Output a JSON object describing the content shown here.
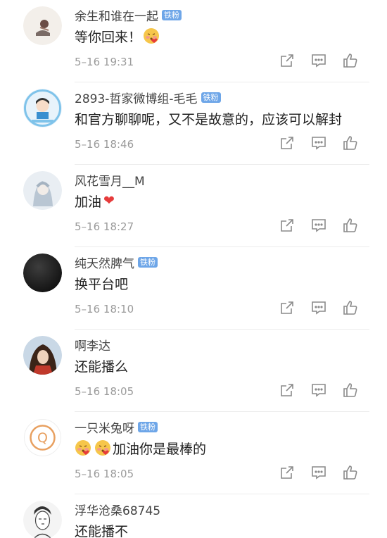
{
  "comments": [
    {
      "username": "余生和谁在一起",
      "badge": "铁粉",
      "text": "等你回来！",
      "emojis_after": 1,
      "emojis_before": 0,
      "time": "5–16 19:31",
      "avatar": "cartoon-figure"
    },
    {
      "username": "2893-哲家微博组-毛毛",
      "badge": "铁粉",
      "text": "和官方聊聊呢，又不是故意的，应该可以解封",
      "emojis_after": 0,
      "emojis_before": 0,
      "time": "5–16 18:46",
      "avatar": "cartoon-boy"
    },
    {
      "username": "风花雪月__M",
      "badge": "",
      "text": "加油",
      "heart": "❤",
      "emojis_after": 0,
      "emojis_before": 0,
      "time": "5–16 18:27",
      "avatar": "anime-girl"
    },
    {
      "username": "纯天然脾气",
      "badge": "铁粉",
      "text": "换平台吧",
      "emojis_after": 0,
      "emojis_before": 0,
      "time": "5–16 18:10",
      "avatar": "dark-circle"
    },
    {
      "username": "啊李达",
      "badge": "",
      "text": "还能播么",
      "emojis_after": 0,
      "emojis_before": 0,
      "time": "5–16 18:05",
      "avatar": "anime-character"
    },
    {
      "username": "一只米兔呀",
      "badge": "铁粉",
      "text": "加油你是最棒的",
      "emojis_after": 0,
      "emojis_before": 2,
      "time": "5–16 18:05",
      "avatar": "letter-q",
      "avatar_letter": "Q"
    },
    {
      "username": "浮华沧桑68745",
      "badge": "",
      "text": "还能播不",
      "emojis_after": 0,
      "emojis_before": 0,
      "time": "",
      "avatar": "sketch-man"
    }
  ],
  "colors": {
    "badge": "#6ea6e8",
    "heart": "#e63b3b",
    "icon": "#8a8a8a",
    "time": "#9b9b9b"
  },
  "icons": {
    "share": "share-icon",
    "comment": "comment-icon",
    "like": "like-icon",
    "emoji": "kiss-face-emoji"
  }
}
